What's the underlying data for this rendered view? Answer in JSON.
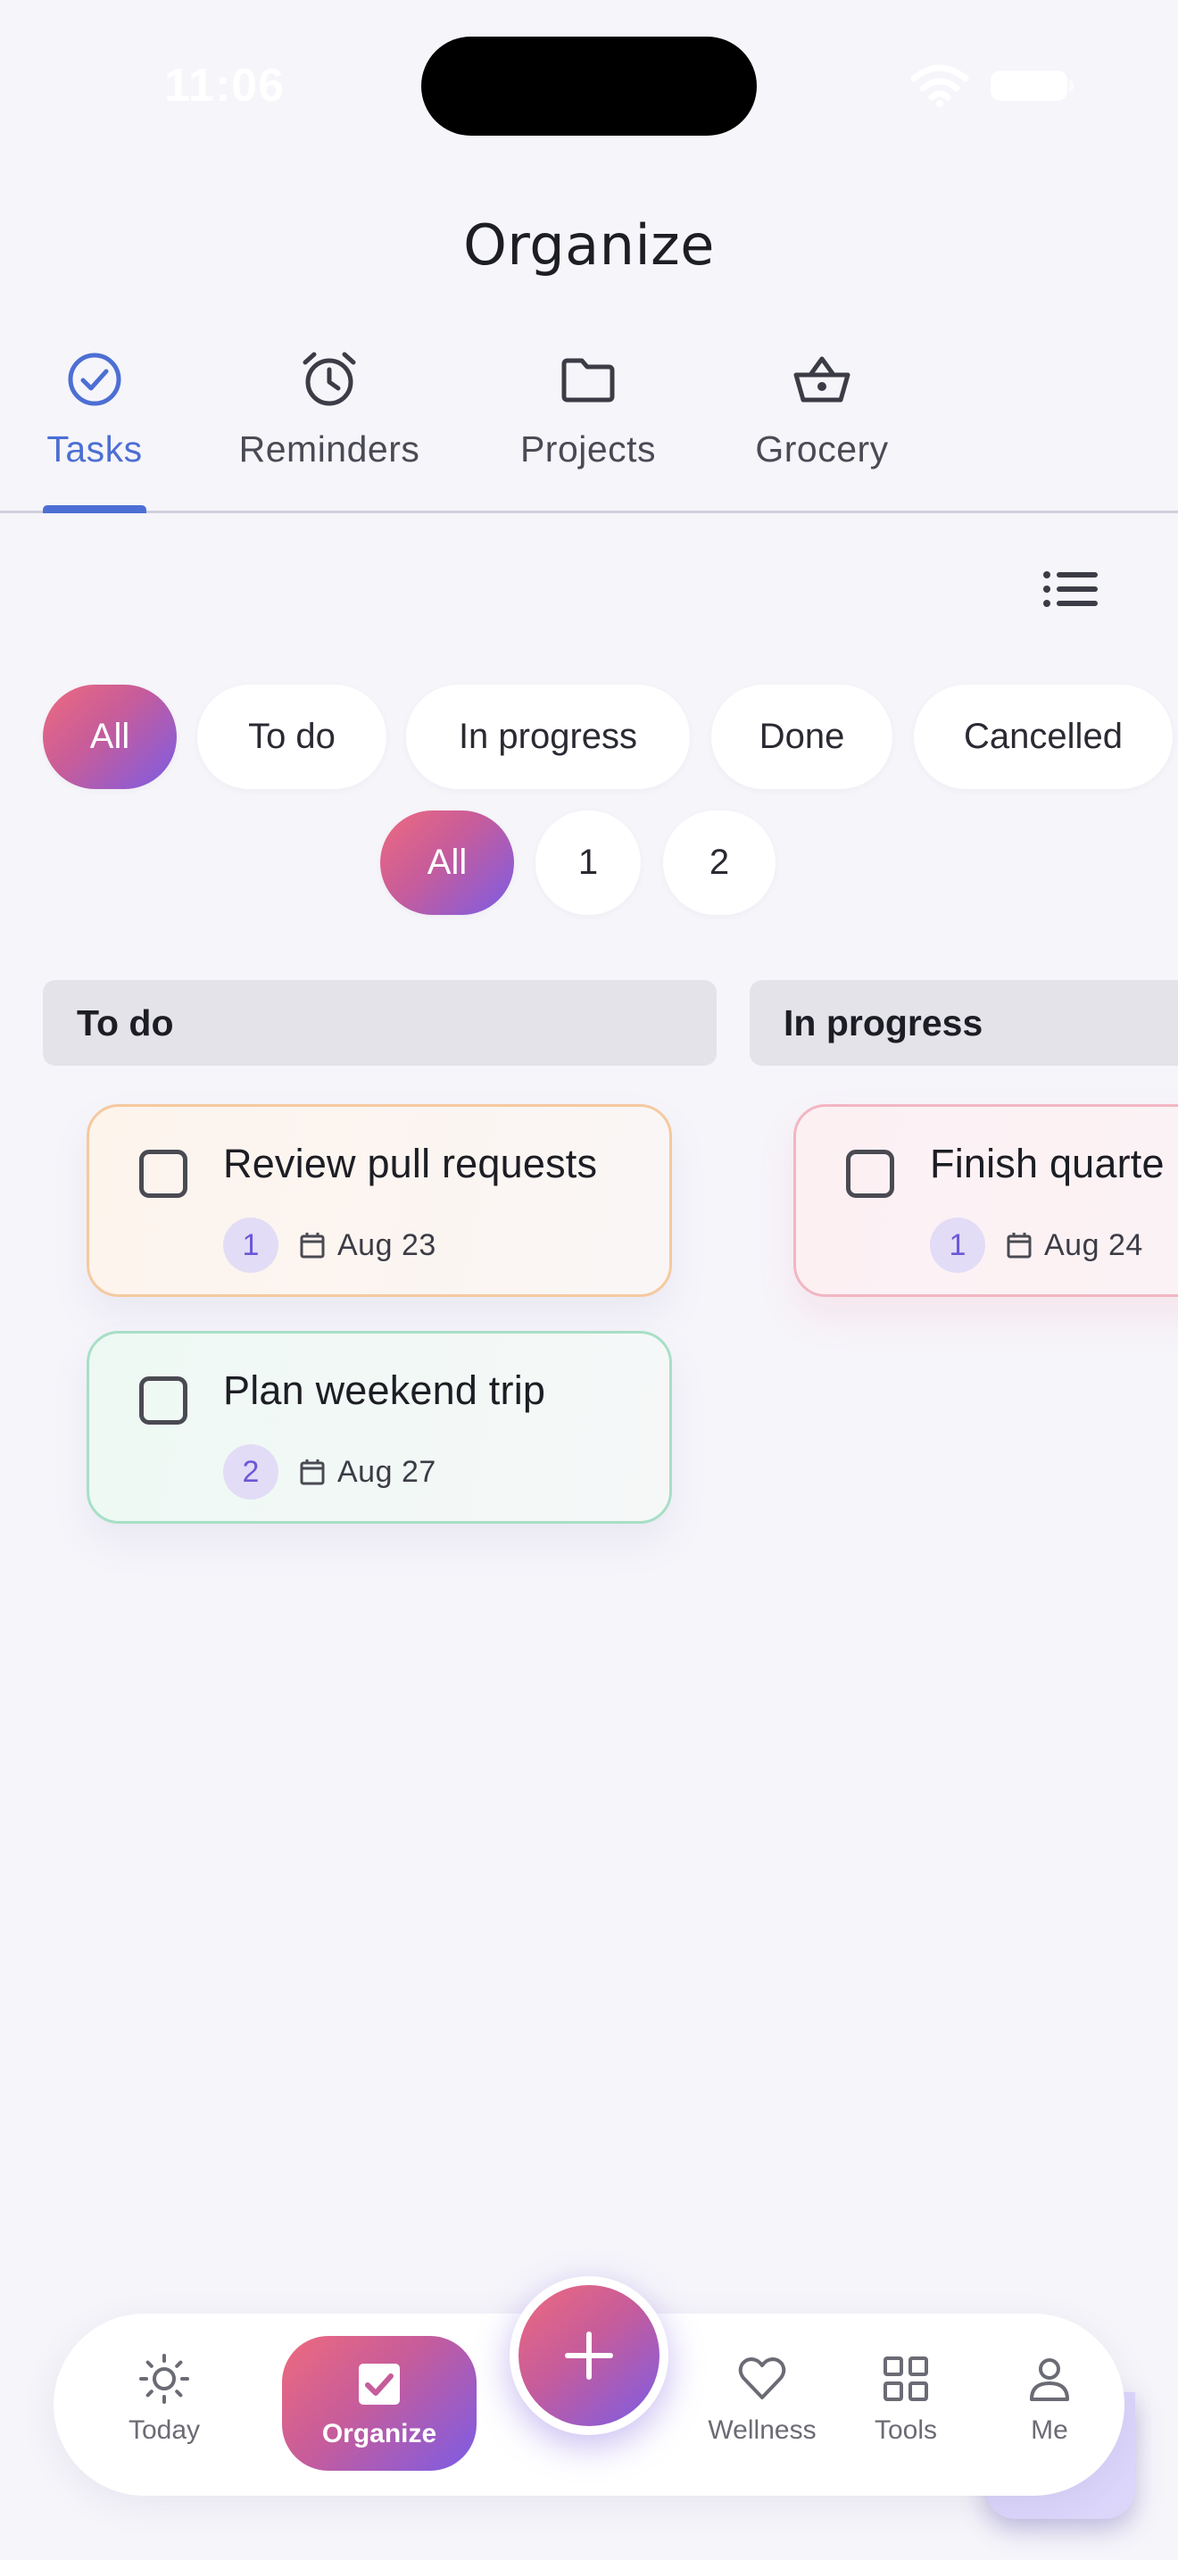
{
  "status_bar": {
    "time": "11:06"
  },
  "page": {
    "title": "Organize"
  },
  "tabs": [
    {
      "label": "Tasks",
      "icon": "check-circle-icon",
      "active": true
    },
    {
      "label": "Reminders",
      "icon": "alarm-clock-icon",
      "active": false
    },
    {
      "label": "Projects",
      "icon": "folder-icon",
      "active": false
    },
    {
      "label": "Grocery",
      "icon": "basket-icon",
      "active": false
    }
  ],
  "status_filters": [
    {
      "label": "All",
      "selected": true
    },
    {
      "label": "To do",
      "selected": false
    },
    {
      "label": "In progress",
      "selected": false
    },
    {
      "label": "Done",
      "selected": false
    },
    {
      "label": "Cancelled",
      "selected": false
    }
  ],
  "priority_filters": [
    {
      "label": "All",
      "selected": true
    },
    {
      "label": "1",
      "selected": false
    },
    {
      "label": "2",
      "selected": false
    }
  ],
  "columns": [
    {
      "title": "To do",
      "tasks": [
        {
          "title": "Review pull requests",
          "priority": "1",
          "date": "Aug 23",
          "accent": "orange"
        },
        {
          "title": "Plan weekend trip",
          "priority": "2",
          "date": "Aug 27",
          "accent": "green"
        }
      ]
    },
    {
      "title": "In progress",
      "tasks": [
        {
          "title": "Finish quarte",
          "priority": "1",
          "date": "Aug 24",
          "accent": "pink"
        }
      ]
    }
  ],
  "bottom_nav": [
    {
      "label": "Today",
      "icon": "sun-icon",
      "active": false
    },
    {
      "label": "Organize",
      "icon": "checkbox-icon",
      "active": true
    },
    {
      "label": "Wellness",
      "icon": "heart-icon",
      "active": false
    },
    {
      "label": "Tools",
      "icon": "grid-icon",
      "active": false
    },
    {
      "label": "Me",
      "icon": "person-icon",
      "active": false
    }
  ],
  "colors": {
    "accent_blue": "#4d6fd4",
    "gradient_start": "#ee6a7e",
    "gradient_end": "#7b5ce6",
    "background": "#f6f5fa"
  }
}
